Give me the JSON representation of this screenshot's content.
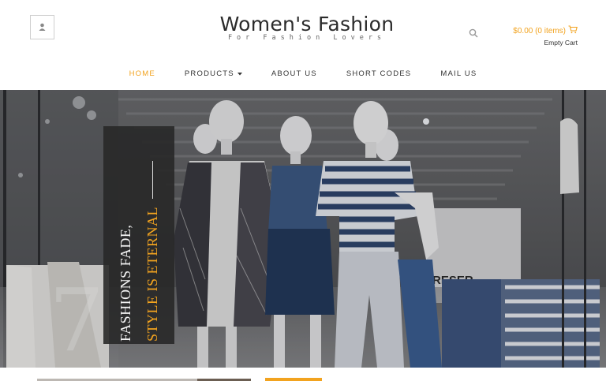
{
  "brand": {
    "title": "Women's Fashion",
    "tagline": "For Fashion Lovers"
  },
  "header": {
    "user_icon": "user-icon",
    "search_icon": "search-icon",
    "cart_icon": "cart-icon"
  },
  "cart": {
    "summary": "$0.00 (0 items)",
    "status": "Empty Cart"
  },
  "nav": {
    "home": "HOME",
    "products": "PRODUCTS",
    "about": "ABOUT US",
    "short_codes": "SHORT CODES",
    "mail": "MAIL US"
  },
  "hero": {
    "line1": "FASHIONS FADE,",
    "line2": "STYLE IS ETERNAL"
  },
  "colors": {
    "accent": "#f2a31f",
    "text": "#333333",
    "overlay": "#282828"
  }
}
